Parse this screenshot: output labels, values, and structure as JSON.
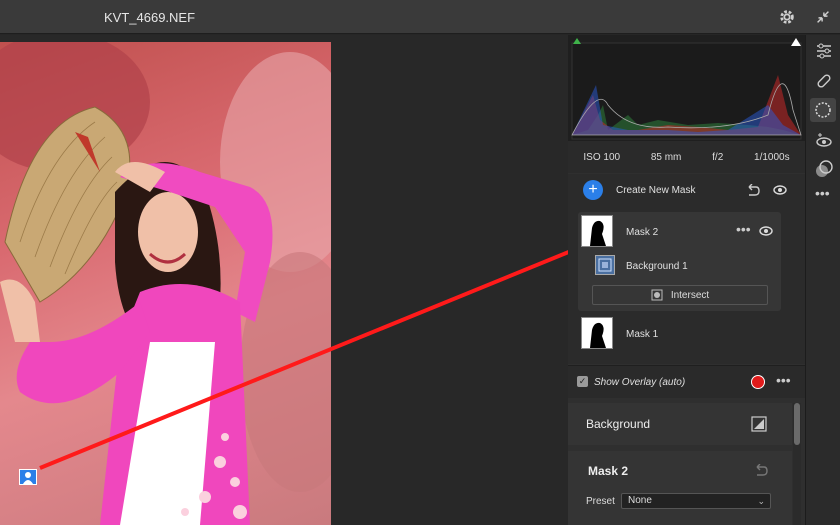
{
  "window": {
    "title": "KVT_4669.NEF"
  },
  "histogram": {},
  "exif": {
    "iso": "ISO 100",
    "focal": "85 mm",
    "aperture": "f/2",
    "shutter": "1/1000s"
  },
  "masks": {
    "create_label": "Create New Mask",
    "items": [
      {
        "name": "Mask 2",
        "component": "Background 1",
        "intersect_label": "Intersect"
      },
      {
        "name": "Mask 1"
      }
    ]
  },
  "overlay": {
    "label": "Show Overlay (auto)",
    "color": "#e11b1b"
  },
  "background_section": {
    "label": "Background"
  },
  "mask2_section": {
    "label": "Mask 2",
    "preset_label": "Preset",
    "preset_value": "None"
  },
  "colors": {
    "accent": "#2b7fe8",
    "annotation": "#ff1a1a"
  }
}
